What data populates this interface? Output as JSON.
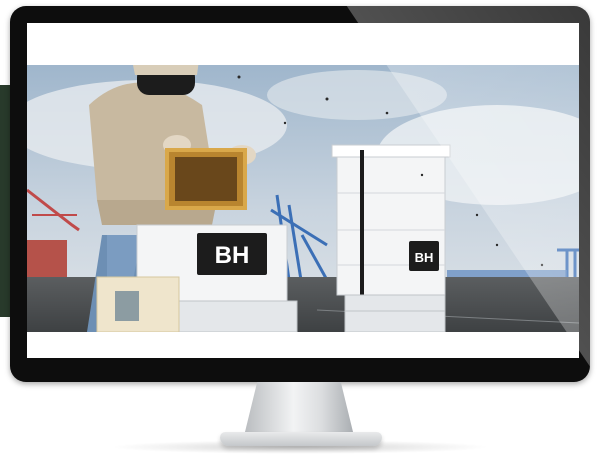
{
  "photo": {
    "hive_logo_letters": "BH"
  },
  "colors": {
    "side_block": "#283a2b",
    "bezel": "#0d0d0d",
    "hive_white": "#f4f5f6",
    "logo_black": "#1c1c1c",
    "sky": "#b9c9d9",
    "crane_blue": "#3b6fb6"
  }
}
